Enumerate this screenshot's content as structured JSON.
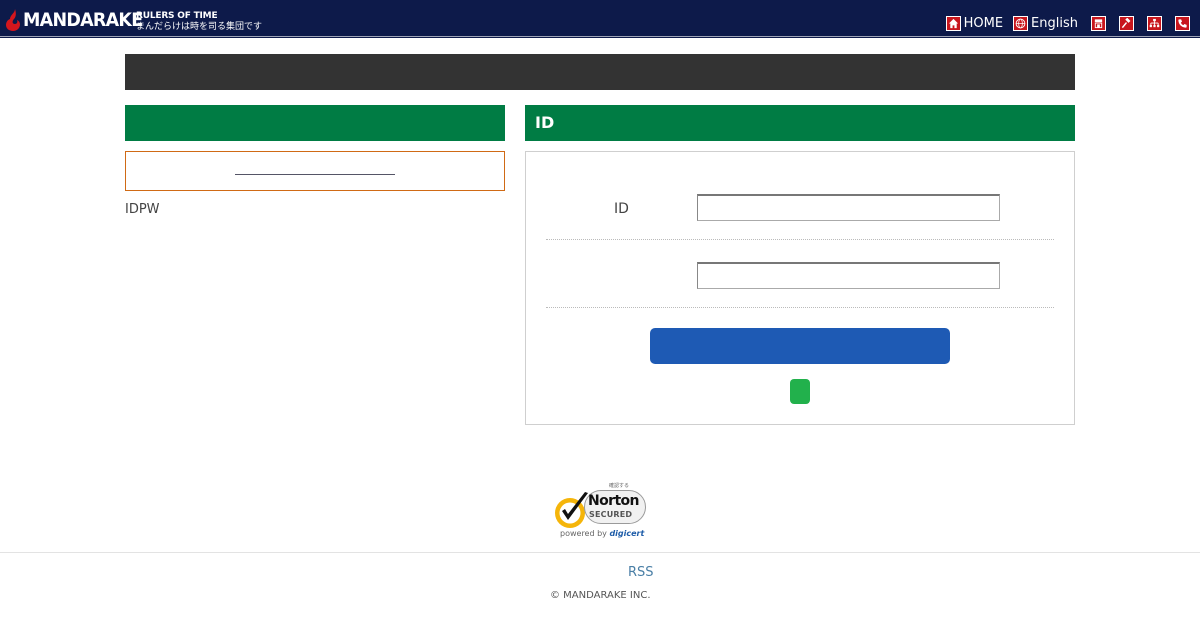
{
  "header": {
    "logo_text": "MANDARAKE",
    "tagline_1": "RULERS OF TIME",
    "tagline_2": "まんだらけは時を司る集団です",
    "nav": {
      "home": "HOME",
      "english": "English"
    },
    "colors": {
      "background": "#0d1a4a",
      "icon_background": "#c8161d"
    }
  },
  "left": {
    "note": "IDPW"
  },
  "right": {
    "heading": "ID",
    "form": {
      "id_label": "ID",
      "id_value": "",
      "password_value": ""
    },
    "colors": {
      "heading": "#007c44",
      "login_button": "#1e5ab4",
      "secondary_button": "#22b14c"
    }
  },
  "badge": {
    "verify": "確認する",
    "name": "Norton",
    "secured": "SECURED",
    "powered_by": "powered by",
    "provider": "digicert"
  },
  "footer": {
    "rss": "RSS",
    "copyright": "© MANDARAKE INC."
  }
}
